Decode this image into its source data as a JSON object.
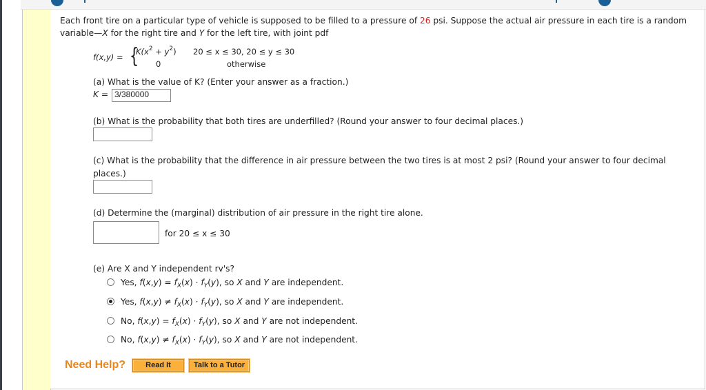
{
  "problem": {
    "intro_line1_a": "Each front tire on a particular type of vehicle is supposed to be filled to a pressure of ",
    "intro_pressure": "26",
    "intro_line1_b": " psi. Suppose the actual air pressure in each tire is a random",
    "intro_line2_a": "variable—",
    "intro_var_x": "X",
    "intro_line2_b": " for the right tire and ",
    "intro_var_y": "Y",
    "intro_line2_c": " for the left tire, with joint pdf",
    "pdf_lhs": "f(x,y) =",
    "pdf_case1_expr_a": "K(x",
    "pdf_case1_expr_b": " + y",
    "pdf_case1_expr_c": ")",
    "pdf_exponent": "2",
    "pdf_case1_cond": "20 ≤ x ≤ 30, 20 ≤ y ≤ 30",
    "pdf_case2_expr": "0",
    "pdf_case2_cond": "otherwise",
    "accent_color": "#cc2222"
  },
  "part_a": {
    "question": "(a) What is the value of K? (Enter your answer as a fraction.)",
    "label": "K =",
    "value": "3/380000"
  },
  "part_b": {
    "question": "(b) What is the probability that both tires are underfilled? (Round your answer to four decimal places.)",
    "value": ""
  },
  "part_c": {
    "question_line1": "(c) What is the probability that the difference in air pressure between the two tires is at most 2 psi? (Round your answer to four decimal",
    "question_line2": "places.)",
    "value": ""
  },
  "part_d": {
    "question": "(d) Determine the (marginal) distribution of air pressure in the right tire alone.",
    "value": "",
    "suffix": "for 20 ≤ x ≤ 30"
  },
  "part_e": {
    "question": "(e) Are X and Y independent rv's?",
    "selected_index": 1,
    "options": [
      {
        "label": "Yes, f(x,y) = fX(x) · fY(y), so X and Y are independent."
      },
      {
        "label": "Yes, f(x,y) ≠ fX(x) · fY(y), so X and Y are independent."
      },
      {
        "label": "No, f(x,y) = fX(x) · fY(y), so X and Y are not independent."
      },
      {
        "label": "No, f(x,y) ≠ fX(x) · fY(y), so X and Y are not independent."
      }
    ]
  },
  "help": {
    "title": "Need Help?",
    "read_it": "Read It",
    "talk_to_tutor": "Talk to a Tutor",
    "color": "#e8851b"
  }
}
